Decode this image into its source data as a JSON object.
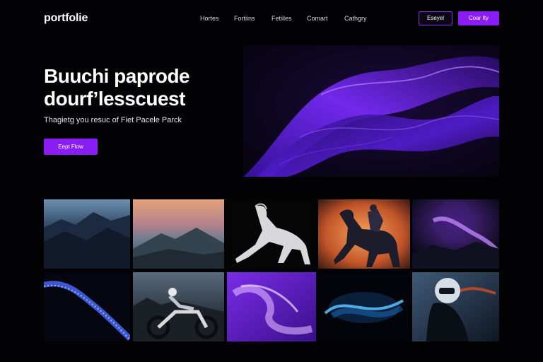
{
  "brand": {
    "logo": "portfolie"
  },
  "nav": {
    "links": [
      "Hortes",
      "Fortiins",
      "Fetiiles",
      "Comart",
      "Cathgry"
    ],
    "outline_button": "Eseyel",
    "solid_button": "Coar Ity"
  },
  "hero": {
    "title_line1": "Buuchi paprode",
    "title_line2": "dourf’lesscuest",
    "subtitle": "Thagietg you resuc of Fiet Pacele Parck",
    "cta": "Eept Flow"
  },
  "colors": {
    "background": "#020205",
    "accent": "#8a1cf5",
    "accent_outline": "#8f2df8"
  },
  "gallery": {
    "items": [
      "mountain-ridge-dusk",
      "misty-mountains-sunset",
      "white-horse-rearing",
      "horse-rider-orange",
      "purple-smoke-night-hills",
      "blue-particle-wave",
      "motorcycle-rider",
      "purple-smoke-swirl",
      "blue-glow-swirl",
      "helmet-rider-portrait"
    ]
  }
}
